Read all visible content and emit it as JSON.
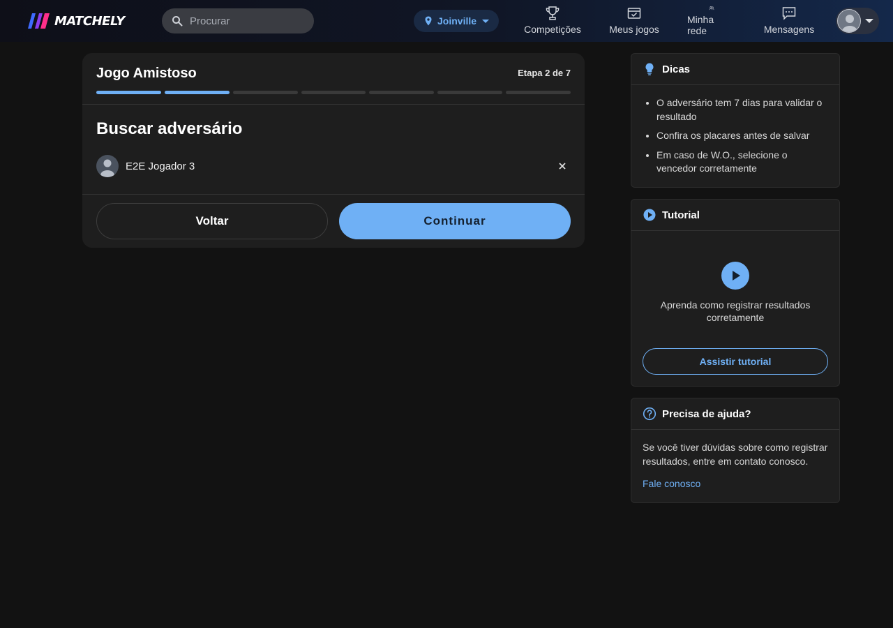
{
  "app": {
    "logo_text": "MATCHELY"
  },
  "header": {
    "search_placeholder": "Procurar",
    "city": "Joinville",
    "nav": [
      {
        "label": "Competições",
        "icon": "trophy-icon"
      },
      {
        "label": "Meus jogos",
        "icon": "calendar-check-icon"
      },
      {
        "label": "Minha rede",
        "icon": "people-icon"
      },
      {
        "label": "Mensagens",
        "icon": "chat-icon"
      }
    ]
  },
  "wizard": {
    "title": "Jogo Amistoso",
    "step_label": "Etapa 2 de 7",
    "steps_total": 7,
    "steps_completed": 2,
    "section_title": "Buscar adversário",
    "opponent_name": "E2E Jogador 3",
    "back_label": "Voltar",
    "continue_label": "Continuar"
  },
  "tips": {
    "title": "Dicas",
    "items": [
      "O adversário tem 7 dias para validar o resultado",
      "Confira os placares antes de salvar",
      "Em caso de W.O., selecione o vencedor corretamente"
    ]
  },
  "tutorial": {
    "title": "Tutorial",
    "text": "Aprenda como registrar resultados corretamente",
    "button_label": "Assistir tutorial"
  },
  "help": {
    "title": "Precisa de ajuda?",
    "text": "Se você tiver dúvidas sobre como registrar resultados, entre em contato conosco.",
    "link_label": "Fale conosco"
  },
  "colors": {
    "accent": "#6fb0f5",
    "background": "#121212",
    "card": "#1e1e1e"
  }
}
